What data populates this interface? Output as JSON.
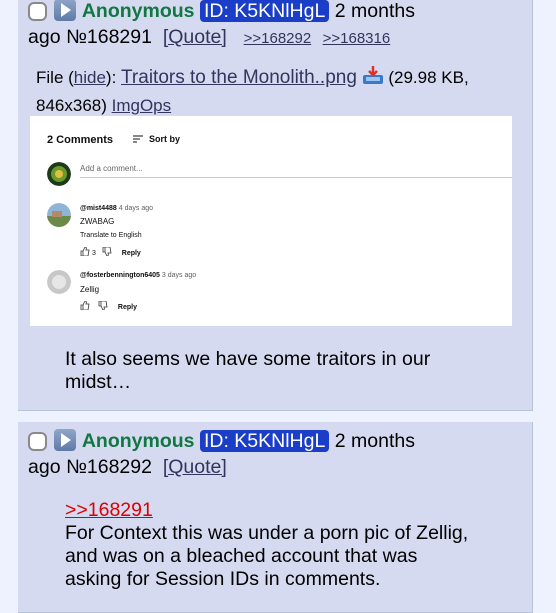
{
  "post1": {
    "name": "Anonymous",
    "id_label": "ID: K5KNlHgL",
    "time": "2 months",
    "time2": "ago",
    "number": "№168291",
    "quote_label": "[Quote]",
    "backlinks": [
      ">>168292",
      ">>168316"
    ],
    "file_prefix": "File (",
    "file_hide": "hide",
    "file_mid": "): ",
    "file_name": "Traitors to the Monolith..png",
    "file_info": "(29.98 KB,",
    "file_dims": "846x368)",
    "imgops": "ImgOps",
    "message_line1": "It also seems we have some traitors in our",
    "message_line2": "midst…",
    "thumbnail": {
      "comments_count": "2 Comments",
      "sort_label": "Sort by",
      "add_placeholder": "Add a comment...",
      "comments": [
        {
          "handle": "@mist4488",
          "ago": "4 days ago",
          "text": "ZWABAG",
          "translate": "Translate to English",
          "likes": "3",
          "reply": "Reply"
        },
        {
          "handle": "@fosterbennington6405",
          "ago": "3 days ago",
          "text": "Zellig",
          "reply": "Reply"
        }
      ]
    }
  },
  "post2": {
    "name": "Anonymous",
    "id_label": "ID: K5KNlHgL",
    "time": "2 months",
    "time2": "ago",
    "number": "№168292",
    "quote_label": "[Quote]",
    "quote_ref": ">>168291",
    "message_lines": [
      "For Context this was under a porn pic of Zellig,",
      "and was on a bleached account that was",
      "asking for Session IDs in comments."
    ]
  },
  "colors": {
    "post_bg": "#d6daf0",
    "page_bg": "#eef2ff",
    "name": "#117743",
    "id_badge": "#1b3ec8",
    "quote_link": "#dd0000",
    "link": "#34345c"
  }
}
